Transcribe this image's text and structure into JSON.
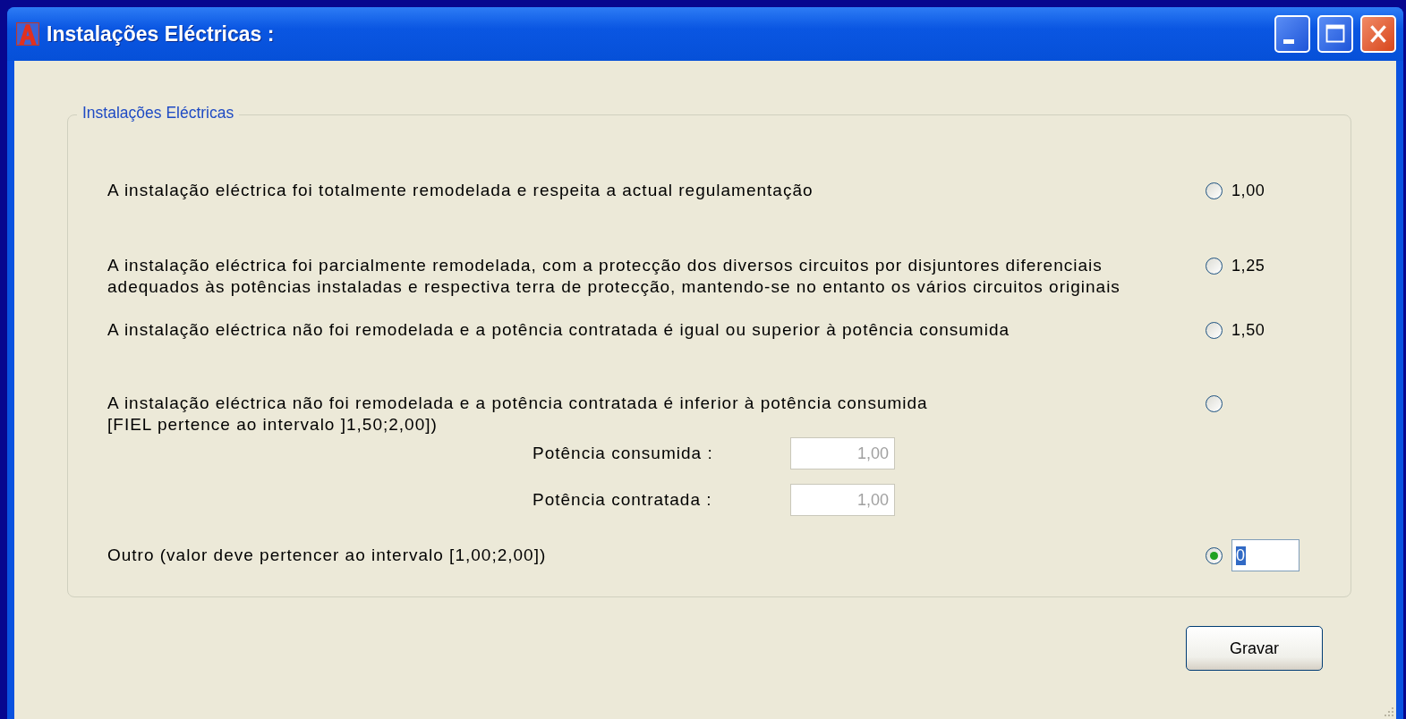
{
  "window": {
    "title": "Instalações Eléctricas :"
  },
  "group": {
    "legend": "Instalações Eléctricas",
    "options": [
      {
        "kind": "radio",
        "lines": [
          "A instalação eléctrica foi totalmente remodelada e respeita a actual regulamentação"
        ],
        "value": "1,00",
        "selected": false
      },
      {
        "kind": "radio",
        "lines": [
          "A instalação eléctrica foi parcialmente remodelada, com a protecção dos diversos circuitos por disjuntores diferenciais",
          "adequados às potências instaladas e respectiva terra de protecção, mantendo-se no entanto os vários circuitos originais"
        ],
        "value": "1,25",
        "selected": false
      },
      {
        "kind": "radio",
        "lines": [
          "A instalação eléctrica não foi remodelada e a potência contratada é igual ou superior à potência consumida"
        ],
        "value": "1,50",
        "selected": false
      },
      {
        "kind": "fields",
        "lines": [
          "A instalação eléctrica não foi remodelada e a potência contratada é inferior à potência consumida",
          "[FIEL pertence ao intervalo ]1,50;2,00])"
        ],
        "selected": false,
        "fields": [
          {
            "label": "Potência consumida :",
            "value": "1,00",
            "disabled": true
          },
          {
            "label": "Potência contratada :",
            "value": "1,00",
            "disabled": true
          }
        ]
      },
      {
        "kind": "input",
        "lines": [
          "Outro (valor deve pertencer ao intervalo [1,00;2,00])"
        ],
        "selected": true,
        "input": {
          "value": "0",
          "focused": true
        }
      }
    ]
  },
  "buttons": [
    {
      "label": "Gravar"
    }
  ]
}
